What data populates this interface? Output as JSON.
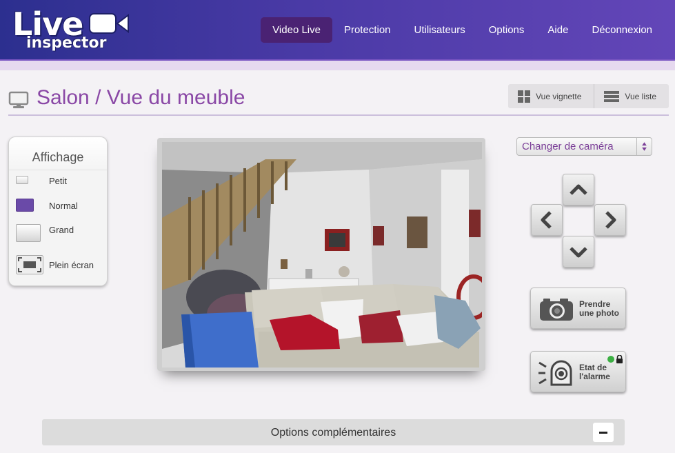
{
  "header": {
    "logo_line1": "Live",
    "logo_line2": "inspector",
    "nav": [
      {
        "label": "Video Live",
        "active": true
      },
      {
        "label": "Protection"
      },
      {
        "label": "Utilisateurs"
      },
      {
        "label": "Options"
      },
      {
        "label": "Aide"
      },
      {
        "label": "Déconnexion"
      }
    ]
  },
  "page": {
    "title": "Salon / Vue du meuble",
    "view_thumb_label": "Vue vignette",
    "view_list_label": "Vue liste"
  },
  "affichage": {
    "title": "Affichage",
    "items": [
      {
        "label": "Petit"
      },
      {
        "label": "Normal",
        "selected": true
      },
      {
        "label": "Grand"
      },
      {
        "label": "Plein écran"
      }
    ]
  },
  "controls": {
    "camera_select_label": "Changer de caméra",
    "photo_label_1": "Prendre",
    "photo_label_2": "une photo",
    "alarm_label_1": "Etat de",
    "alarm_label_2": "l'alarme"
  },
  "options": {
    "label": "Options complémentaires"
  },
  "colors": {
    "accent": "#8a48a6",
    "nav_active": "#4a2273",
    "alarm_status": "#3cb043"
  }
}
